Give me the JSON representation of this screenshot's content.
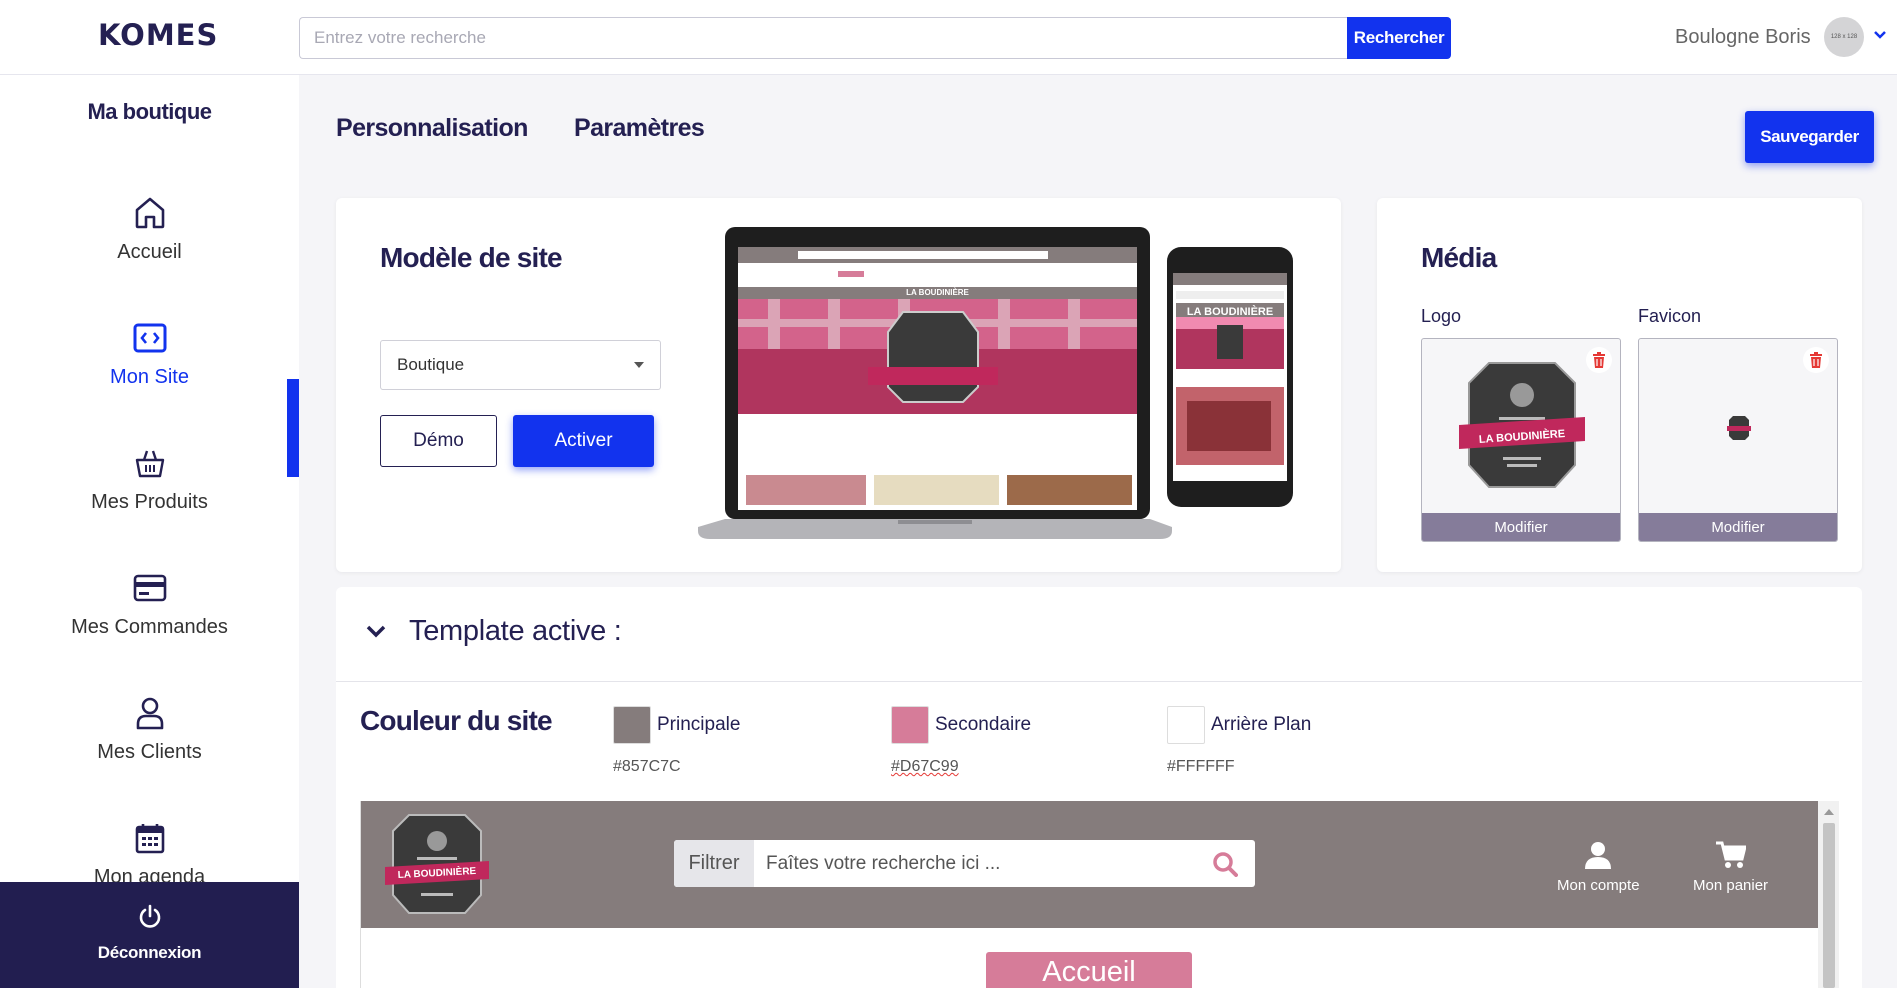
{
  "app": {
    "logo_text": "KOMES"
  },
  "search": {
    "placeholder": "Entrez votre recherche",
    "button_label": "Rechercher"
  },
  "user": {
    "name": "Boulogne Boris",
    "avatar_text": "128 x 128"
  },
  "sidebar": {
    "title": "Ma boutique",
    "items": [
      {
        "label": "Accueil",
        "icon": "home-icon"
      },
      {
        "label": "Mon Site",
        "icon": "code-icon",
        "active": true
      },
      {
        "label": "Mes Produits",
        "icon": "basket-icon"
      },
      {
        "label": "Mes Commandes",
        "icon": "credit-card-icon"
      },
      {
        "label": "Mes Clients",
        "icon": "user-icon"
      },
      {
        "label": "Mon agenda",
        "icon": "calendar-icon"
      }
    ],
    "logout_label": "Déconnexion"
  },
  "tabs": {
    "personnalisation": "Personnalisation",
    "parametres": "Paramètres"
  },
  "toolbar": {
    "save_label": "Sauvegarder"
  },
  "modele": {
    "title": "Modèle de site",
    "select_value": "Boutique",
    "demo_label": "Démo",
    "activate_label": "Activer"
  },
  "media": {
    "title": "Média",
    "logo_label": "Logo",
    "favicon_label": "Favicon",
    "modify_label": "Modifier"
  },
  "template": {
    "title": "Template active :",
    "couleur_title": "Couleur du site",
    "colors": [
      {
        "label": "Principale",
        "hex": "#857C7C"
      },
      {
        "label": "Secondaire",
        "hex": "#D67C99"
      },
      {
        "label": "Arrière Plan",
        "hex": "#FFFFFF"
      }
    ]
  },
  "preview": {
    "filter_label": "Filtrer",
    "search_placeholder": "Faîtes votre recherche ici ...",
    "account_label": "Mon compte",
    "cart_label": "Mon panier",
    "nav_label": "Accueil",
    "shop_name": "LA BOUDINIÈRE"
  },
  "colors": {
    "accent": "#1233EE",
    "navy": "#242052",
    "sidebar_footer": "#221E50"
  }
}
